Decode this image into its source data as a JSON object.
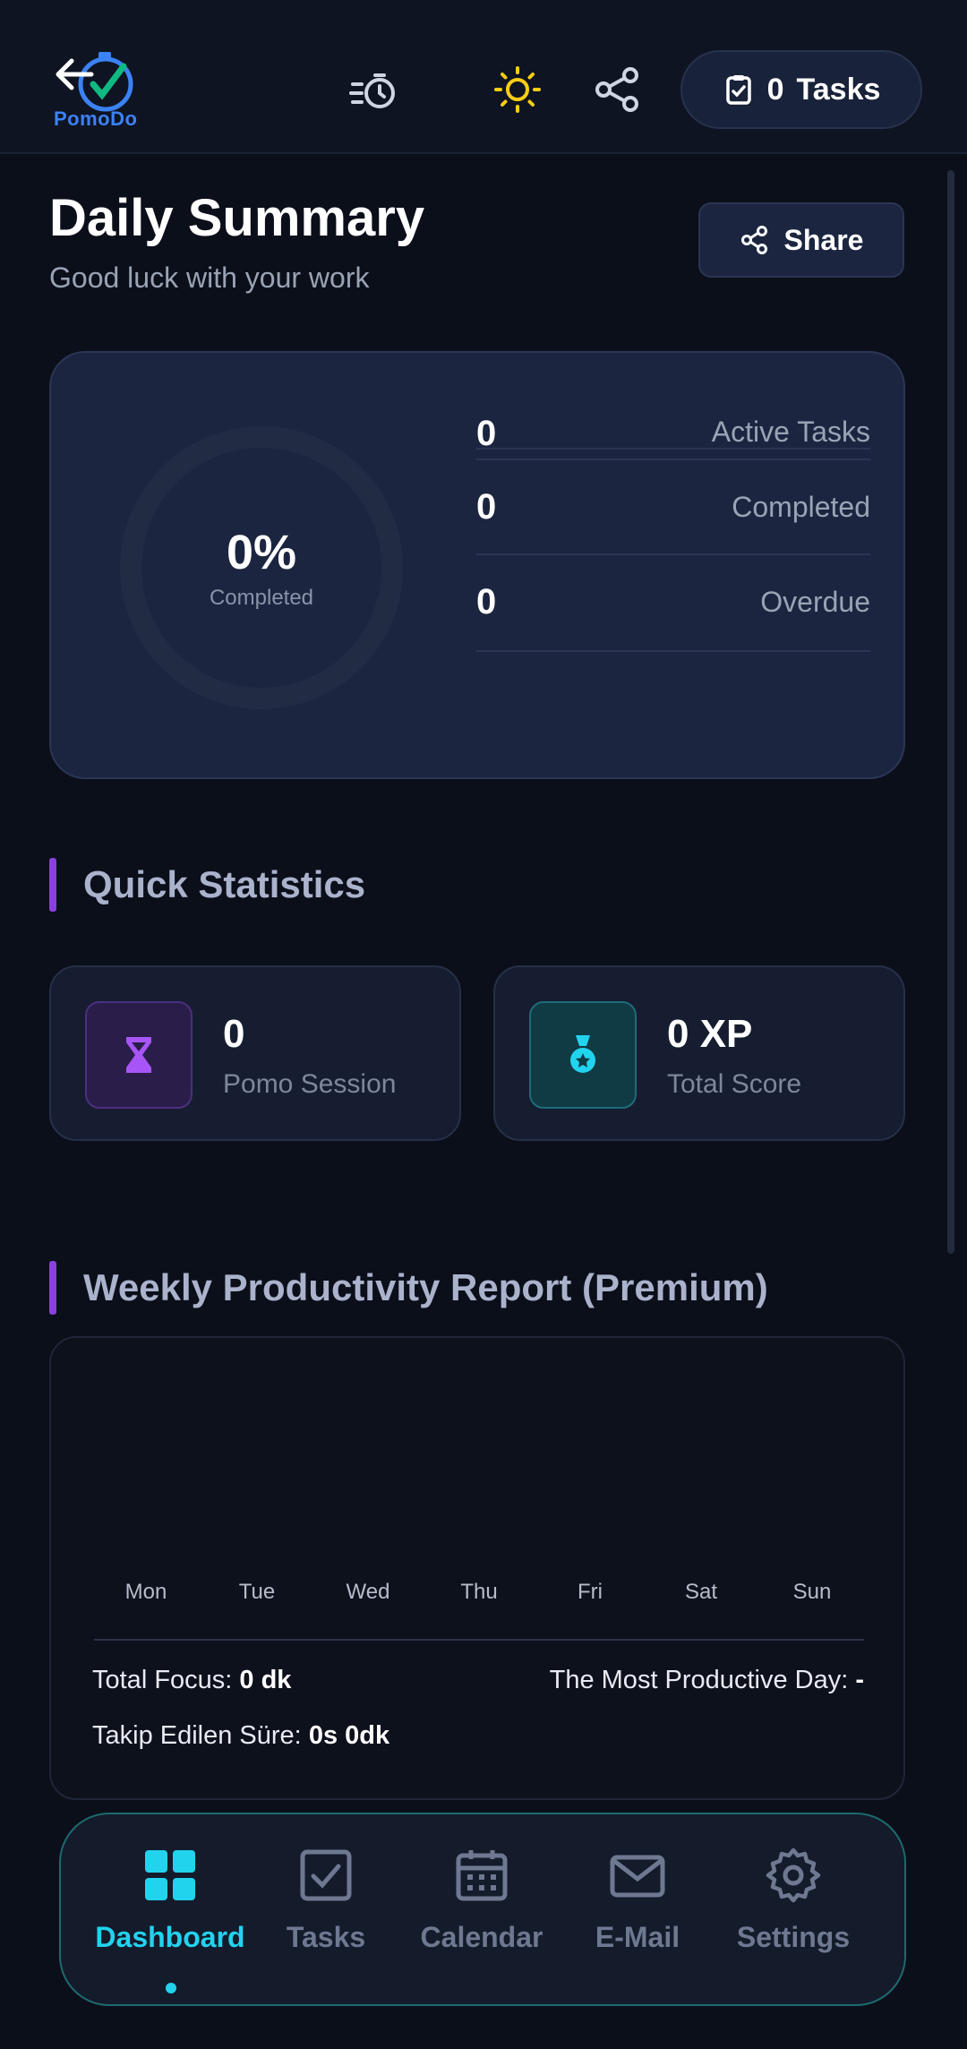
{
  "header": {
    "logo_text": "PomoDo",
    "tasks_count": "0",
    "tasks_label": "Tasks",
    "icons": [
      "back-arrow-icon",
      "timer-icon",
      "sun-icon",
      "share-icon",
      "clipboard-check-icon"
    ]
  },
  "summary": {
    "title": "Daily Summary",
    "subtitle": "Good luck with your work",
    "share_label": "Share",
    "percent": "0%",
    "percent_label": "Completed",
    "progress_fraction": 0,
    "stats": [
      {
        "value": "0",
        "label": "Active Tasks"
      },
      {
        "value": "0",
        "label": "Completed"
      },
      {
        "value": "0",
        "label": "Overdue"
      }
    ]
  },
  "quick": {
    "heading": "Quick Statistics",
    "cards": [
      {
        "value": "0",
        "label": "Pomo Session",
        "icon": "hourglass-icon",
        "color": "#a855f7"
      },
      {
        "value": "0 XP",
        "label": "Total Score",
        "icon": "medal-icon",
        "color": "#22d3ee"
      }
    ]
  },
  "weekly": {
    "heading": "Weekly Productivity Report (Premium)",
    "days": [
      "Mon",
      "Tue",
      "Wed",
      "Thu",
      "Fri",
      "Sat",
      "Sun"
    ],
    "total_focus_label": "Total Focus:",
    "total_focus_value": "0 dk",
    "productive_day_label": "The Most Productive Day:",
    "productive_day_value": "-",
    "tracked_label": "Takip Edilen Süre:",
    "tracked_value": "0s 0dk"
  },
  "nav": {
    "items": [
      {
        "label": "Dashboard",
        "icon": "dashboard-icon",
        "active": true
      },
      {
        "label": "Tasks",
        "icon": "tasks-icon",
        "active": false
      },
      {
        "label": "Calendar",
        "icon": "calendar-icon",
        "active": false
      },
      {
        "label": "E-Mail",
        "icon": "mail-icon",
        "active": false
      },
      {
        "label": "Settings",
        "icon": "gear-icon",
        "active": false
      }
    ]
  },
  "colors": {
    "background": "#0b0f1a",
    "accent_cyan": "#22d3ee",
    "accent_purple": "#8b3fe0",
    "sun_yellow": "#facc15",
    "logo_blue": "#3b82f6"
  }
}
